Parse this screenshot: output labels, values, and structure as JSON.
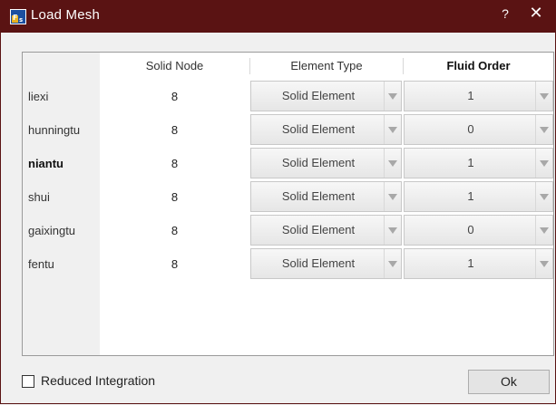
{
  "window": {
    "title": "Load Mesh",
    "help_label": "?",
    "close_label": "✕",
    "titlebar_color": "#5a1313"
  },
  "table": {
    "columns": [
      "Solid Node",
      "Element Type",
      "Fluid Order"
    ],
    "rows": [
      {
        "label": "liexi",
        "bold": false,
        "solid_node": "8",
        "element_type": "Solid Element",
        "fluid_order": "1"
      },
      {
        "label": "hunningtu",
        "bold": false,
        "solid_node": "8",
        "element_type": "Solid Element",
        "fluid_order": "0"
      },
      {
        "label": "niantu",
        "bold": true,
        "solid_node": "8",
        "element_type": "Solid Element",
        "fluid_order": "1"
      },
      {
        "label": "shui",
        "bold": false,
        "solid_node": "8",
        "element_type": "Solid Element",
        "fluid_order": "1"
      },
      {
        "label": "gaixingtu",
        "bold": false,
        "solid_node": "8",
        "element_type": "Solid Element",
        "fluid_order": "0"
      },
      {
        "label": "fentu",
        "bold": false,
        "solid_node": "8",
        "element_type": "Solid Element",
        "fluid_order": "1"
      }
    ]
  },
  "options": {
    "reduced_integration_label": "Reduced Integration",
    "reduced_integration_checked": false
  },
  "buttons": {
    "ok_label": "Ok"
  }
}
